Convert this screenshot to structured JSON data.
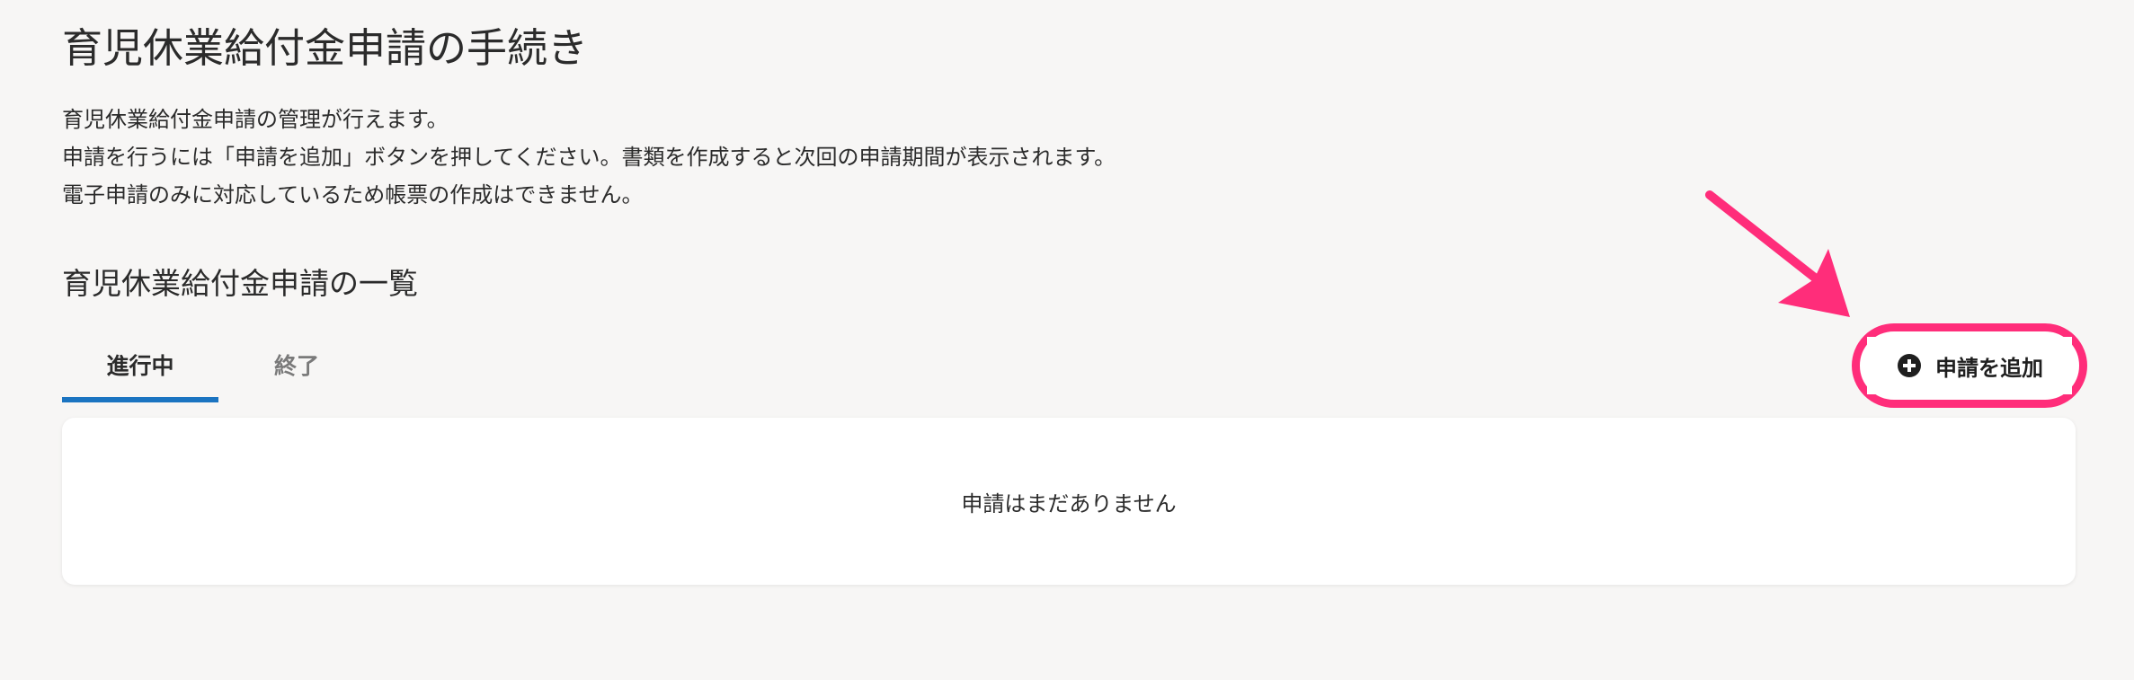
{
  "page": {
    "title": "育児休業給付金申請の手続き",
    "description": [
      "育児休業給付金申請の管理が行えます。",
      "申請を行うには「申請を追加」ボタンを押してください。書類を作成すると次回の申請期間が表示されます。",
      "電子申請のみに対応しているため帳票の作成はできません。"
    ]
  },
  "list": {
    "section_title": "育児休業給付金申請の一覧",
    "tabs": [
      {
        "label": "進行中",
        "active": true
      },
      {
        "label": "終了",
        "active": false
      }
    ],
    "add_button": {
      "label": "申請を追加",
      "icon": "plus-circle-icon"
    },
    "empty_message": "申請はまだありません"
  },
  "colors": {
    "background": "#f7f6f5",
    "tab_underline": "#1b74c1",
    "highlight": "#ff2d7a"
  }
}
